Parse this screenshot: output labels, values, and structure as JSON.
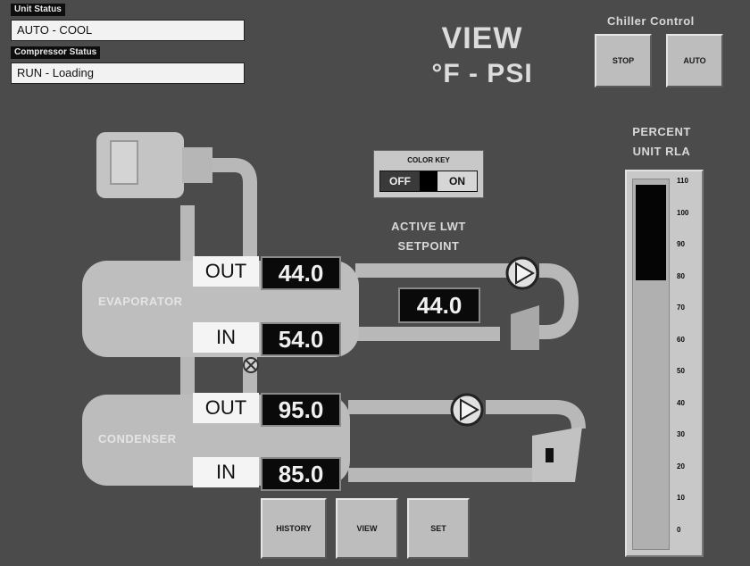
{
  "status": {
    "unit_status_caption": "Unit Status",
    "unit_status_value": "AUTO - COOL",
    "compressor_status_caption": "Compressor Status",
    "compressor_status_value": "RUN - Loading"
  },
  "view_title": {
    "line1": "VIEW",
    "line2": "°F - PSI"
  },
  "chiller_control": {
    "title": "Chiller Control",
    "stop_label": "STOP",
    "auto_label": "AUTO"
  },
  "color_key": {
    "title": "COLOR KEY",
    "off_label": "OFF",
    "on_label": "ON"
  },
  "setpoint": {
    "line1": "ACTIVE LWT",
    "line2": "SETPOINT",
    "value": "44.0"
  },
  "evaporator": {
    "label": "EVAPORATOR",
    "out_label": "OUT",
    "out_value": "44.0",
    "in_label": "IN",
    "in_value": "54.0"
  },
  "condenser": {
    "label": "CONDENSER",
    "out_label": "OUT",
    "out_value": "95.0",
    "in_label": "IN",
    "in_value": "85.0"
  },
  "rla": {
    "title_line1": "PERCENT",
    "title_line2": "UNIT RLA",
    "level_percent": 80,
    "ticks": [
      "110",
      "100",
      "90",
      "80",
      "70",
      "60",
      "50",
      "40",
      "30",
      "20",
      "10",
      "0"
    ]
  },
  "nav": {
    "history_label": "HISTORY",
    "view_label": "VIEW",
    "set_label": "SET"
  },
  "colors": {
    "background": "#4b4b4b",
    "equipment": "#bdbdbd",
    "value_box": "#0a0a0a"
  }
}
